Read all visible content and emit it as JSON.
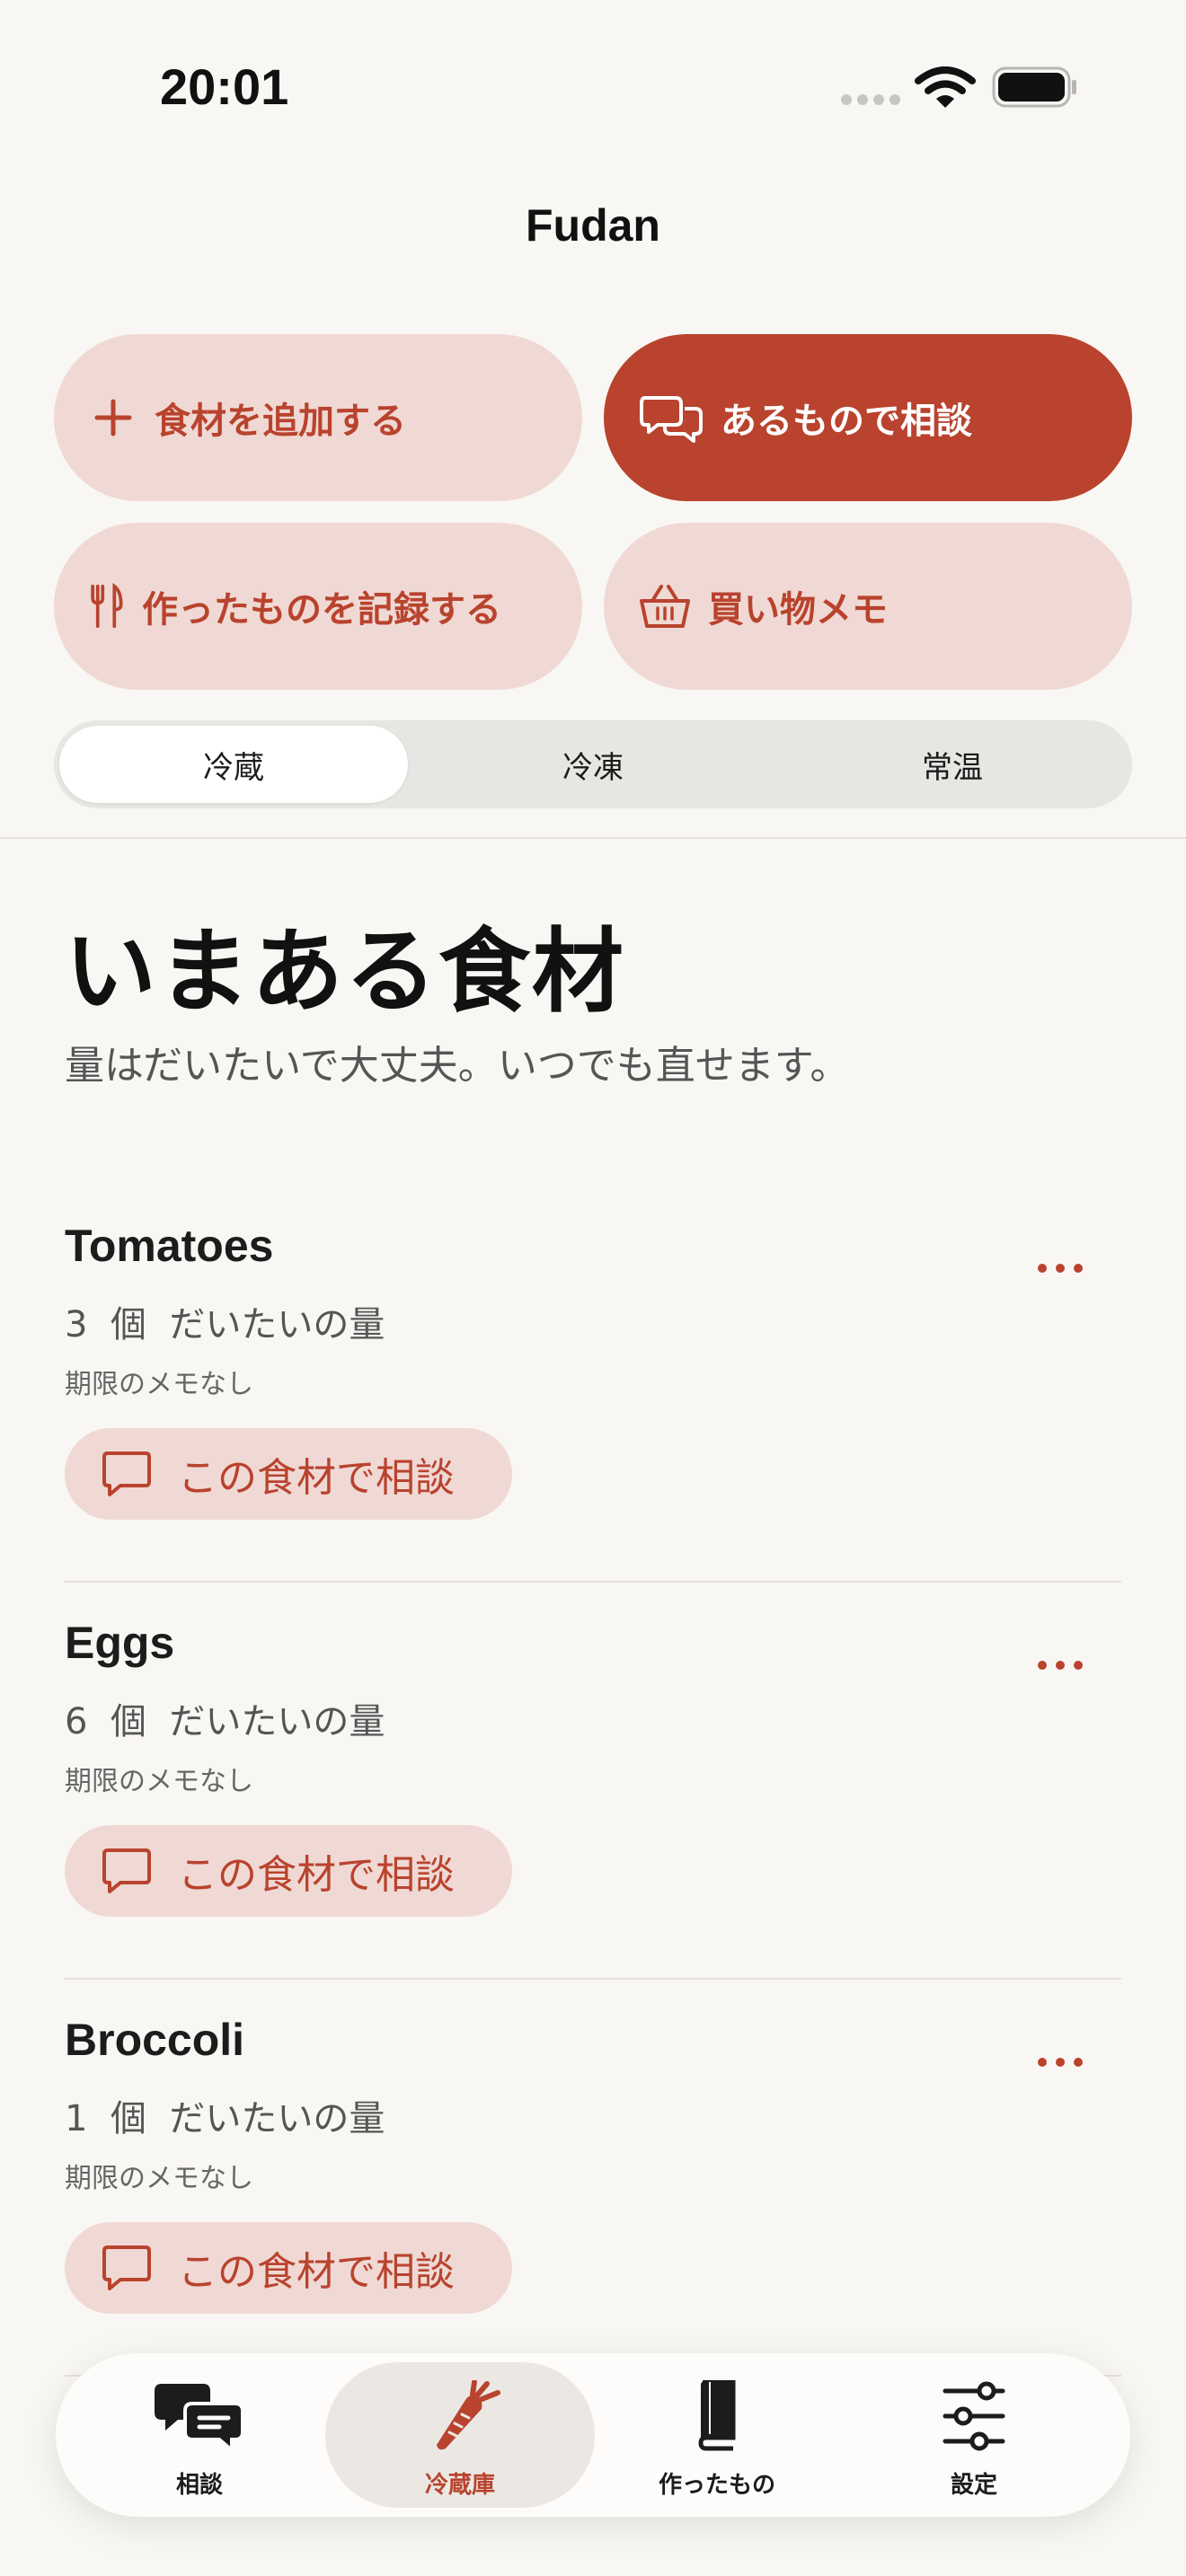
{
  "status_bar": {
    "time": "20:01"
  },
  "nav": {
    "title": "Fudan"
  },
  "actions": {
    "add_ingredient": "食材を追加する",
    "consult_with_what_we_have": "あるもので相談",
    "record_made": "作ったものを記録する",
    "shopping_memo": "買い物メモ"
  },
  "storage_tabs": [
    {
      "label": "冷蔵",
      "selected": true
    },
    {
      "label": "冷凍",
      "selected": false
    },
    {
      "label": "常温",
      "selected": false
    }
  ],
  "section": {
    "title": "いまある食材",
    "subtitle": "量はだいたいで大丈夫。いつでも直せます。"
  },
  "ingredients": [
    {
      "name": "Tomatoes",
      "quantity": "3",
      "unit": "個",
      "amount_note": "だいたいの量",
      "expiry": "期限のメモなし",
      "consult_label": "この食材で相談"
    },
    {
      "name": "Eggs",
      "quantity": "6",
      "unit": "個",
      "amount_note": "だいたいの量",
      "expiry": "期限のメモなし",
      "consult_label": "この食材で相談"
    },
    {
      "name": "Broccoli",
      "quantity": "1",
      "unit": "個",
      "amount_note": "だいたいの量",
      "expiry": "期限のメモなし",
      "consult_label": "この食材で相談"
    }
  ],
  "tab_bar": [
    {
      "label": "相談",
      "icon": "chat-bubbles-icon",
      "selected": false
    },
    {
      "label": "冷蔵庫",
      "icon": "carrot-icon",
      "selected": true
    },
    {
      "label": "作ったもの",
      "icon": "book-icon",
      "selected": false
    },
    {
      "label": "設定",
      "icon": "sliders-icon",
      "selected": false
    }
  ],
  "colors": {
    "accent": "#b9432e",
    "accent_soft": "#f0d9d4",
    "background": "#f9f7f4",
    "text": "#1c1c1c",
    "secondary_text": "#555555"
  }
}
